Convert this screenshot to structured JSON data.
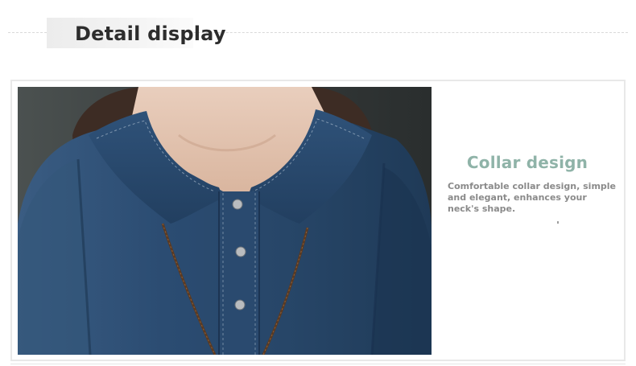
{
  "header": {
    "title": "Detail display"
  },
  "feature": {
    "title": "Collar design",
    "description": "Comfortable collar design, simple and elegant, enhances your neck's shape."
  },
  "colors": {
    "title_text": "#2d2d2d",
    "accent": "#8fb3a8",
    "description_text": "#8a8a8a",
    "denim": "#2a4a6e",
    "backdrop": "#3e4343",
    "skin": "#e3c7b3",
    "hair": "#3d2c24"
  }
}
